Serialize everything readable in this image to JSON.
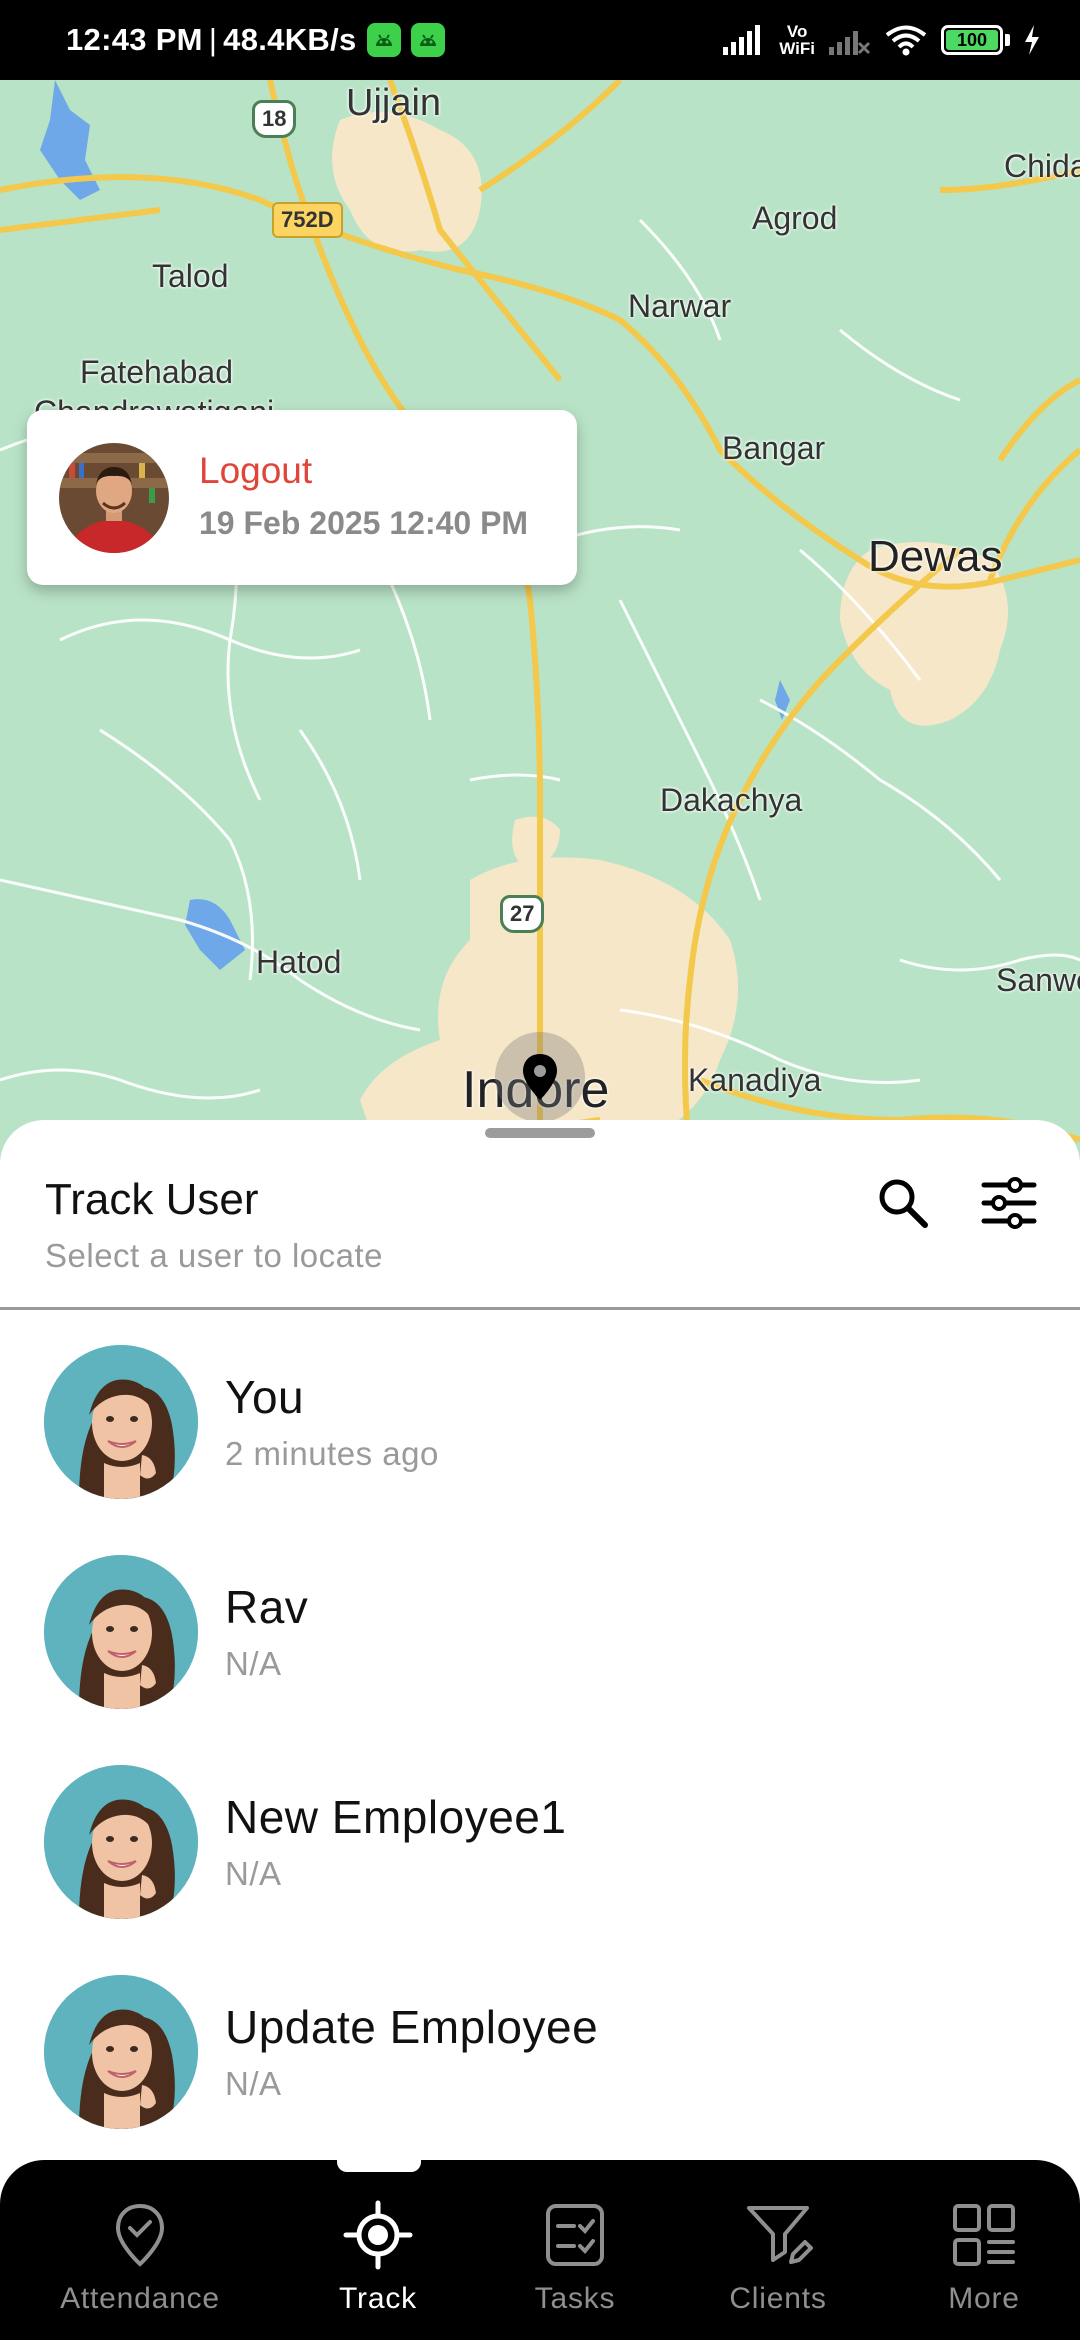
{
  "status_bar": {
    "time": "12:43 PM",
    "separator": "|",
    "speed": "48.4KB/s",
    "vowifi_top": "Vo",
    "vowifi_bottom": "WiFi",
    "battery": "100",
    "battery_fraction": 1.0
  },
  "map": {
    "places": {
      "ujjain": "Ujjain",
      "chida": "Chida",
      "agrod": "Agrod",
      "talod": "Talod",
      "narwar": "Narwar",
      "fatehabad": "Fatehabad",
      "chandrawatiganj": "Chandrawatiganj",
      "bangar": "Bangar",
      "dewas": "Dewas",
      "dakachya": "Dakachya",
      "hatod": "Hatod",
      "sanwer": "Sanwer",
      "kanadiya": "Kanadiya",
      "indore": "Indore"
    },
    "shields": {
      "nh18": "18",
      "nh752d": "752D",
      "nh27": "27"
    },
    "colors": {
      "land": "#b9e3c7",
      "city": "#f6e7c8",
      "road_major": "#f3c84b",
      "road_minor": "#ffffff",
      "water": "#6fa8e8"
    }
  },
  "popup": {
    "status": "Logout",
    "datetime": "19 Feb 2025 12:40 PM"
  },
  "sheet": {
    "title": "Track User",
    "subtitle": "Select a user to locate"
  },
  "users": [
    {
      "name": "You",
      "status": "2 minutes ago"
    },
    {
      "name": "Rav",
      "status": "N/A"
    },
    {
      "name": "New Employee1",
      "status": "N/A"
    },
    {
      "name": "Update Employee",
      "status": "N/A"
    }
  ],
  "nav": {
    "items": [
      {
        "label": "Attendance",
        "icon": "location-check-icon"
      },
      {
        "label": "Track",
        "icon": "crosshair-icon"
      },
      {
        "label": "Tasks",
        "icon": "task-list-icon"
      },
      {
        "label": "Clients",
        "icon": "filter-edit-icon"
      },
      {
        "label": "More",
        "icon": "grid-icon"
      }
    ],
    "active": "Track"
  }
}
